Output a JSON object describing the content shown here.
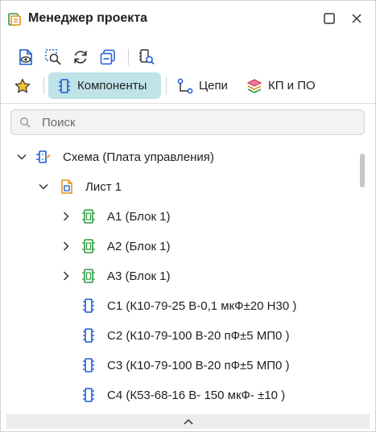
{
  "window": {
    "title": "Менеджер проекта",
    "icons": [
      "app-icon",
      "maximize-icon",
      "close-icon"
    ]
  },
  "toolbar": {
    "buttons": [
      "view-document-icon",
      "zoom-select-icon",
      "refresh-icon",
      "collapse-icon",
      "filter-search-icon"
    ]
  },
  "tabs": [
    {
      "name": "favorites",
      "label": "",
      "icon": "star-icon",
      "active": false
    },
    {
      "name": "components",
      "label": "Компоненты",
      "icon": "component-icon",
      "active": true
    },
    {
      "name": "nets",
      "label": "Цепи",
      "icon": "net-icon",
      "active": false
    },
    {
      "name": "padstacks",
      "label": "КП и ПО",
      "icon": "layers-icon",
      "active": false
    }
  ],
  "search": {
    "placeholder": "Поиск",
    "value": ""
  },
  "tree": {
    "items": [
      {
        "label": "Схема (Плата управления)",
        "level": 0,
        "expanded": true,
        "icon": "schematic-icon"
      },
      {
        "label": "Лист 1",
        "level": 1,
        "expanded": true,
        "icon": "sheet-icon"
      },
      {
        "label": "A1 (Блок 1)",
        "level": 2,
        "expanded": false,
        "icon": "block-icon"
      },
      {
        "label": "A2 (Блок 1)",
        "level": 2,
        "expanded": false,
        "icon": "block-icon"
      },
      {
        "label": "A3 (Блок 1)",
        "level": 2,
        "expanded": false,
        "icon": "block-icon"
      },
      {
        "label": "C1 (К10-79-25 В-0,1 мкФ±20 Н30 )",
        "level": 2,
        "icon": "capacitor-icon"
      },
      {
        "label": "C2 (К10-79-100 В-20 пФ±5 МП0 )",
        "level": 2,
        "icon": "capacitor-icon"
      },
      {
        "label": "C3 (К10-79-100 В-20 пФ±5 МП0 )",
        "level": 2,
        "icon": "capacitor-icon"
      },
      {
        "label": "C4 (К53-68-16 В- 150 мкФ- ±10 )",
        "level": 2,
        "icon": "capacitor-icon"
      }
    ]
  },
  "colors": {
    "accent": "#bfe3e8",
    "icon_blue": "#1a5ad7",
    "icon_green": "#2e9a3d",
    "icon_orange": "#e0941a",
    "star_yellow": "#f2c12e"
  }
}
